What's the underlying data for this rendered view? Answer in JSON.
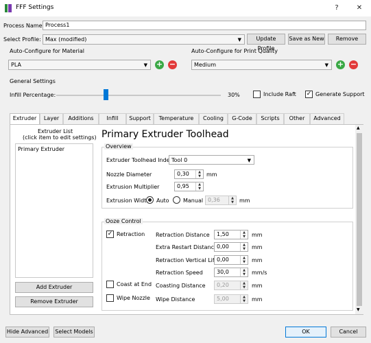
{
  "window": {
    "title": "FFF Settings",
    "help": "?",
    "close": "✕"
  },
  "process_name": {
    "label": "Process Name:",
    "value": "Process1"
  },
  "select_profile": {
    "label": "Select Profile:",
    "value": "Max (modified)"
  },
  "profile_buttons": {
    "update": "Update Profile",
    "save_as_new": "Save as New",
    "remove": "Remove"
  },
  "material": {
    "label": "Auto-Configure for Material",
    "value": "PLA"
  },
  "quality": {
    "label": "Auto-Configure for Print Quality",
    "value": "Medium"
  },
  "general": {
    "label": "General Settings",
    "infill_label": "Infill Percentage:",
    "infill_value": "30%",
    "infill_fraction": 0.3,
    "include_raft": "Include Raft",
    "include_raft_checked": false,
    "generate_support": "Generate Support",
    "generate_support_checked": true
  },
  "tabs": [
    "Extruder",
    "Layer",
    "Additions",
    "Infill",
    "Support",
    "Temperature",
    "Cooling",
    "G-Code",
    "Scripts",
    "Other",
    "Advanced"
  ],
  "active_tab": "Extruder",
  "extruder_list": {
    "title_line1": "Extruder List",
    "title_line2": "(click item to edit settings)",
    "items": [
      "Primary Extruder"
    ],
    "add": "Add Extruder",
    "remove": "Remove Extruder"
  },
  "toolhead": {
    "heading": "Primary Extruder Toolhead",
    "overview": "Overview",
    "index_label": "Extruder Toolhead Index",
    "index_value": "Tool 0",
    "nozzle_label": "Nozzle Diameter",
    "nozzle_value": "0,30",
    "nozzle_unit": "mm",
    "multiplier_label": "Extrusion Multiplier",
    "multiplier_value": "0,95",
    "width_label": "Extrusion Width",
    "width_auto": "Auto",
    "width_manual": "Manual",
    "width_value": "0,36",
    "width_unit": "mm"
  },
  "ooze": {
    "title": "Ooze Control",
    "retraction": "Retraction",
    "retraction_checked": true,
    "retraction_distance_label": "Retraction Distance",
    "retraction_distance": "1,50",
    "extra_restart_label": "Extra Restart Distance",
    "extra_restart": "0,00",
    "vertical_lift_label": "Retraction Vertical Lift",
    "vertical_lift": "0,00",
    "speed_label": "Retraction Speed",
    "speed": "30,0",
    "speed_unit": "mm/s",
    "unit_mm": "mm",
    "coast_label": "Coast at End",
    "coast_checked": false,
    "coasting_distance_label": "Coasting Distance",
    "coasting_distance": "0,20",
    "wipe_label": "Wipe Nozzle",
    "wipe_checked": false,
    "wipe_distance_label": "Wipe Distance",
    "wipe_distance": "5,00"
  },
  "footer": {
    "hide_advanced": "Hide Advanced",
    "select_models": "Select Models",
    "ok": "OK",
    "cancel": "Cancel"
  },
  "colors": {
    "accent": "#0078d7",
    "add": "#3aa845",
    "remove": "#e23a3a"
  }
}
